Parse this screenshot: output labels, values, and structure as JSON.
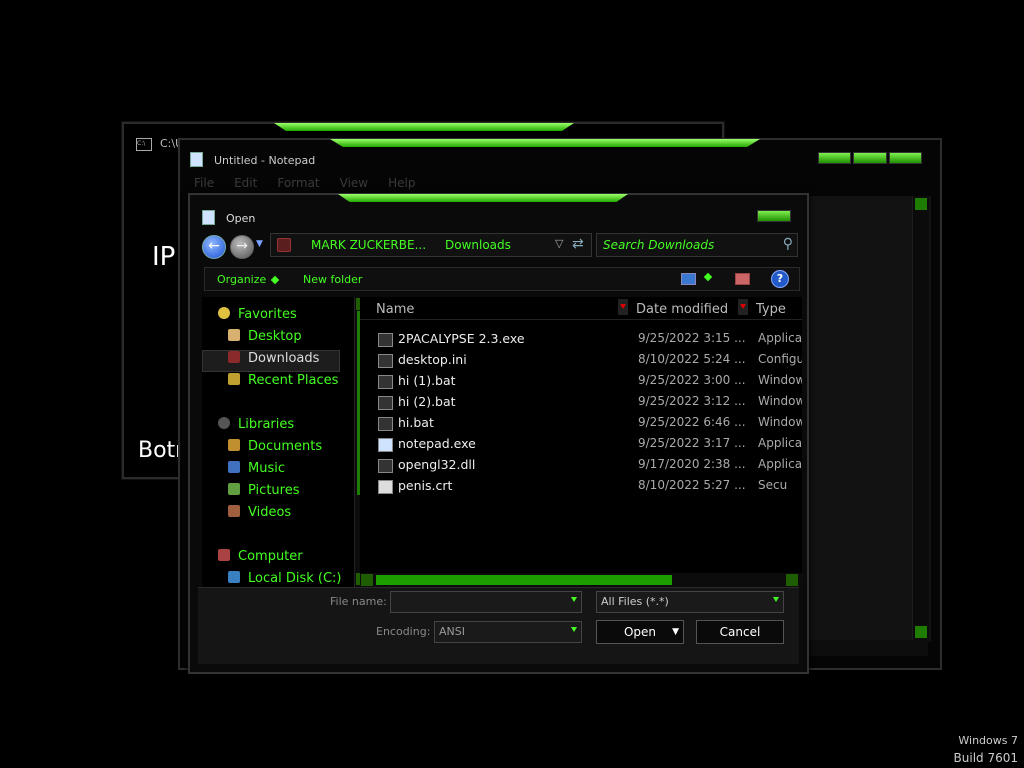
{
  "cmd_window": {
    "title": "C:\\U",
    "text_ip": "IP",
    "text_bot": "Botn"
  },
  "notepad": {
    "title": "Untitled - Notepad",
    "menu": [
      "File",
      "Edit",
      "Format",
      "View",
      "Help"
    ]
  },
  "open_dialog": {
    "title": "Open",
    "address": {
      "crumb1": "MARK ZUCKERBE...",
      "crumb2": "Downloads"
    },
    "search_placeholder": "Search Downloads",
    "toolbar": {
      "organize": "Organize",
      "new_folder": "New folder"
    },
    "nav": [
      {
        "label": "Favorites",
        "icon": "star-icon",
        "color": "#e0c040"
      },
      {
        "label": "Desktop",
        "icon": "desktop-icon",
        "color": "#d8b070"
      },
      {
        "label": "Downloads",
        "icon": "downloads-folder-icon",
        "color": "#8a2a2a"
      },
      {
        "label": "Recent Places",
        "icon": "recent-places-icon",
        "color": "#c0a030"
      },
      {
        "label": "Libraries",
        "icon": "libraries-icon",
        "color": "#555555"
      },
      {
        "label": "Documents",
        "icon": "documents-icon",
        "color": "#c09030"
      },
      {
        "label": "Music",
        "icon": "music-icon",
        "color": "#4070c0"
      },
      {
        "label": "Pictures",
        "icon": "pictures-icon",
        "color": "#60a040"
      },
      {
        "label": "Videos",
        "icon": "videos-icon",
        "color": "#a06040"
      },
      {
        "label": "Computer",
        "icon": "computer-icon",
        "color": "#aa4444"
      },
      {
        "label": "Local Disk (C:)",
        "icon": "disk-icon",
        "color": "#3a80c0"
      }
    ],
    "columns": {
      "name": "Name",
      "date": "Date modified",
      "type": "Type"
    },
    "files": [
      {
        "name": "2PACALYPSE 2.3.exe",
        "date": "9/25/2022 3:15 ...",
        "type": "Applica",
        "icon": "console-exe-icon"
      },
      {
        "name": "desktop.ini",
        "date": "8/10/2022 5:24 ...",
        "type": "Configu",
        "icon": "settings-file-icon"
      },
      {
        "name": "hi (1).bat",
        "date": "9/25/2022 3:00 ...",
        "type": "Window",
        "icon": "batch-file-icon"
      },
      {
        "name": "hi (2).bat",
        "date": "9/25/2022 3:12 ...",
        "type": "Window",
        "icon": "batch-file-icon"
      },
      {
        "name": "hi.bat",
        "date": "9/25/2022 6:46 ...",
        "type": "Window",
        "icon": "batch-file-icon"
      },
      {
        "name": "notepad.exe",
        "date": "9/25/2022 3:17 ...",
        "type": "Applica",
        "icon": "notepad-exe-icon"
      },
      {
        "name": "opengl32.dll",
        "date": "9/17/2020 2:38 ...",
        "type": "Applica",
        "icon": "dll-file-icon"
      },
      {
        "name": "penis.crt",
        "date": "8/10/2022 5:27 ...",
        "type": "Secu",
        "icon": "certificate-icon"
      }
    ],
    "file_name_label": "File name:",
    "file_name_value": "",
    "file_type": "All Files  (*.*)",
    "encoding_label": "Encoding:",
    "encoding_value": "ANSI",
    "open_button": "Open",
    "cancel_button": "Cancel"
  },
  "watermark": {
    "os_name": "Windows 7",
    "build": "Build 7601"
  },
  "colors": {
    "accent": "#44ff22",
    "glow": "#22a800"
  }
}
